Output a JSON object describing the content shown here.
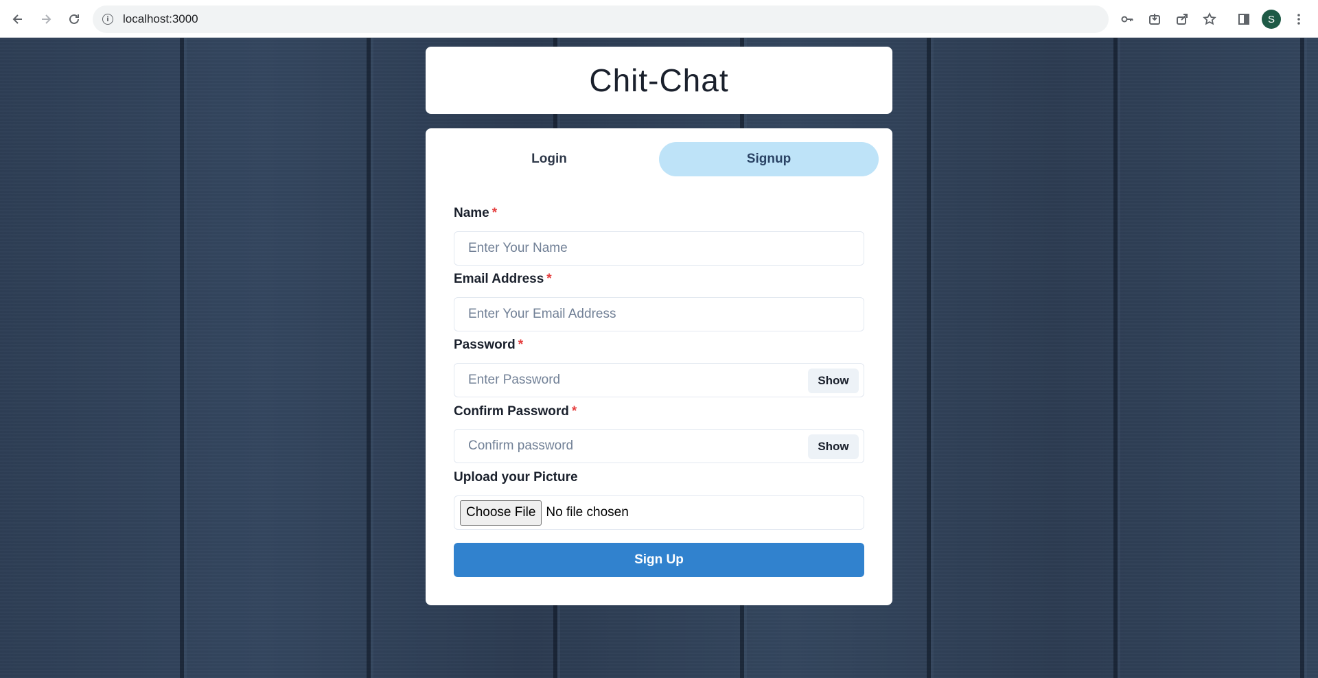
{
  "browser": {
    "url": "localhost:3000",
    "back_icon": "arrow-left-icon",
    "forward_icon": "arrow-right-icon",
    "reload_icon": "reload-icon",
    "profile_initial": "S"
  },
  "header": {
    "title": "Chit-Chat"
  },
  "tabs": [
    {
      "label": "Login",
      "active": false
    },
    {
      "label": "Signup",
      "active": true
    }
  ],
  "form": {
    "name": {
      "label": "Name",
      "required": "*",
      "placeholder": "Enter Your Name"
    },
    "email": {
      "label": "Email Address",
      "required": "*",
      "placeholder": "Enter Your Email Address"
    },
    "password": {
      "label": "Password",
      "required": "*",
      "placeholder": "Enter Password",
      "toggle": "Show"
    },
    "confirm": {
      "label": "Confirm Password",
      "required": "*",
      "placeholder": "Confirm password",
      "toggle": "Show"
    },
    "picture": {
      "label": "Upload your Picture",
      "button": "Choose File",
      "status": "No file chosen"
    },
    "submit": "Sign Up"
  },
  "colors": {
    "accent": "#3182ce",
    "active_tab": "#bee3f8",
    "required": "#e53e3e",
    "background": "#2f4058"
  }
}
